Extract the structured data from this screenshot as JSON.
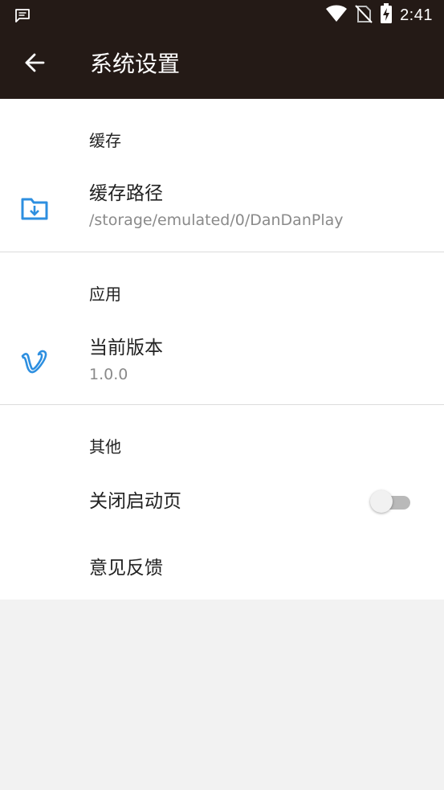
{
  "status_bar": {
    "time": "2:41",
    "icons": [
      "message-icon",
      "wifi-icon",
      "no-sim-icon",
      "battery-charging-icon"
    ]
  },
  "app_bar": {
    "back_icon": "arrow-back-icon",
    "title": "系统设置"
  },
  "sections": {
    "cache": {
      "header": "缓存",
      "items": {
        "cache_path": {
          "icon": "folder-download-icon",
          "title": "缓存路径",
          "summary": "/storage/emulated/0/DanDanPlay"
        }
      }
    },
    "app": {
      "header": "应用",
      "items": {
        "version": {
          "icon": "vimeo-v-icon",
          "title": "当前版本",
          "summary": "1.0.0"
        }
      }
    },
    "other": {
      "header": "其他",
      "items": {
        "close_splash": {
          "title": "关闭启动页",
          "toggle_on": false
        },
        "feedback": {
          "title": "意见反馈"
        }
      }
    }
  },
  "colors": {
    "app_bar": "#241a16",
    "accent_icon": "#2d8fe0",
    "background": "#f2f2f2"
  }
}
